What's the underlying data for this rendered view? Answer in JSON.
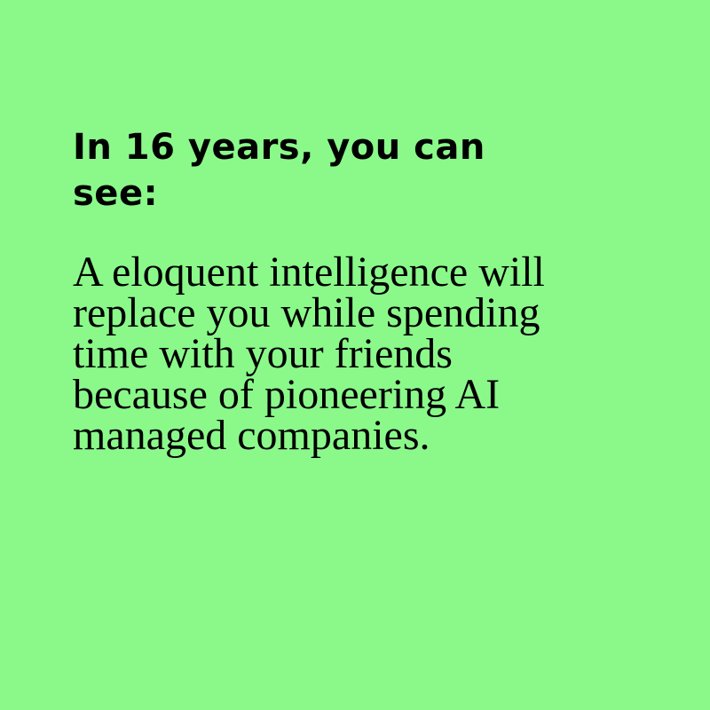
{
  "colors": {
    "background": "#8af98a",
    "text": "#000000"
  },
  "card": {
    "headline": "In 16 years, you can see:",
    "body": "A eloquent intelligence will replace you while spending time with your friends because of pioneering AI managed companies."
  }
}
